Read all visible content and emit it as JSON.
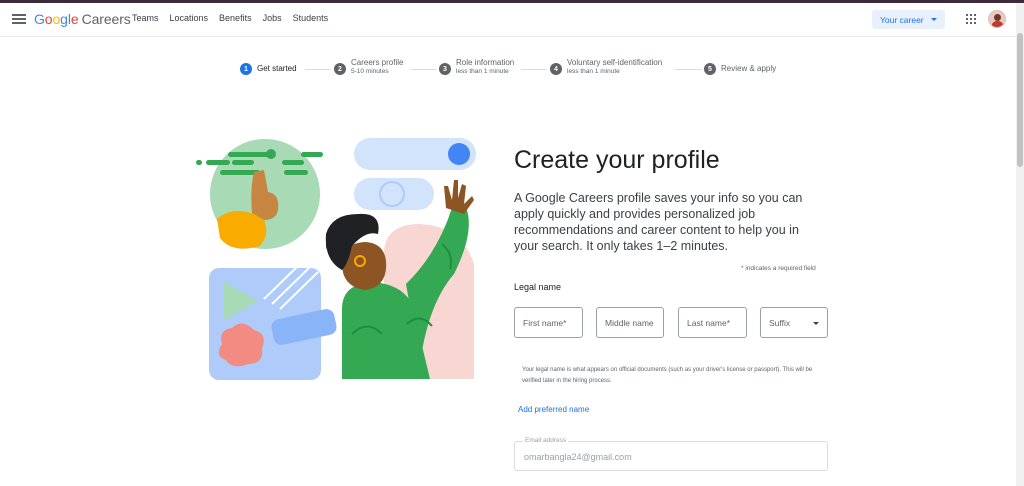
{
  "header": {
    "logo_google": [
      "G",
      "o",
      "o",
      "g",
      "l",
      "e"
    ],
    "logo_careers": "Careers",
    "nav": [
      "Teams",
      "Locations",
      "Benefits",
      "Jobs",
      "Students"
    ],
    "career_button": "Your career"
  },
  "stepper": {
    "steps": [
      {
        "num": "1",
        "label": "Get started",
        "sub": ""
      },
      {
        "num": "2",
        "label": "Careers profile",
        "sub": "5-10 minutes"
      },
      {
        "num": "3",
        "label": "Role information",
        "sub": "less than 1 minute"
      },
      {
        "num": "4",
        "label": "Voluntary self-identification",
        "sub": "less than 1 minute"
      },
      {
        "num": "5",
        "label": "Review & apply",
        "sub": ""
      }
    ],
    "active_step": 1
  },
  "form": {
    "title": "Create your profile",
    "description": "A Google Careers profile saves your info so you can apply quickly and provides personalized job recommendations and career content to help you in your search. It only takes 1–2 minutes.",
    "required_note": "* indicates a required field",
    "legal_name_label": "Legal name",
    "first_name_placeholder": "First name*",
    "middle_name_placeholder": "Middle name",
    "last_name_placeholder": "Last name*",
    "suffix_placeholder": "Suffix",
    "legal_help": "Your legal name is what appears on official documents (such as your driver's license or passport). This will be verified later in the hiring process.",
    "add_preferred_name": "Add preferred name",
    "email_label": "Email address",
    "email_value": "omarbangla24@gmail.com"
  },
  "colors": {
    "accent": "#1a73e8",
    "step_inactive": "#5f6368",
    "illus_green": "#2e7d32",
    "illus_blue": "#aecbfa",
    "illus_pink": "#f8d7d3"
  }
}
